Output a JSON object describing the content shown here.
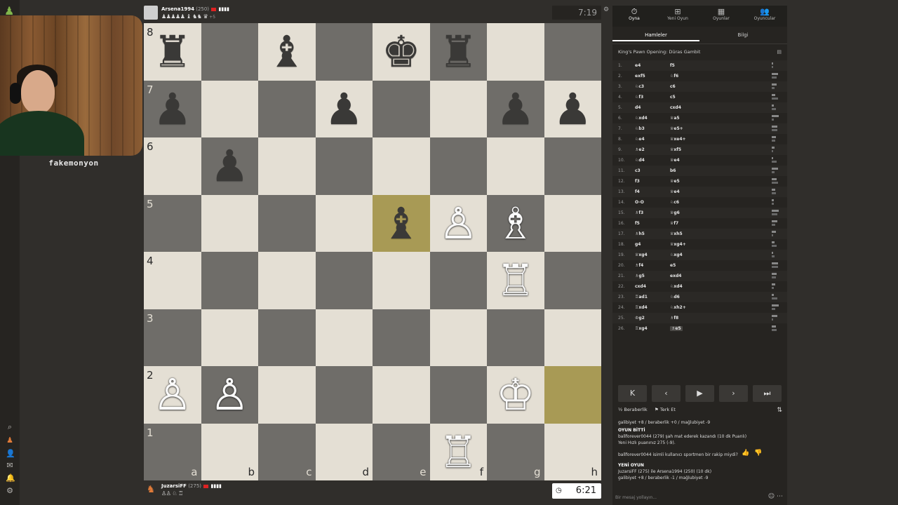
{
  "streamer": {
    "name": "fakemonyon"
  },
  "sidebar": {
    "icons": [
      "search-icon",
      "pawn-icon",
      "friends-icon",
      "messages-icon",
      "bell-icon",
      "gear-icon"
    ],
    "logo": "♟"
  },
  "top_player": {
    "name": "Arsena1994",
    "rating": "(250)",
    "bars": "▮▮▮▮",
    "captured": "♟♟♟♟♟ ♝ ♞♞ ♛",
    "advantage": "+5",
    "clock": "7:19"
  },
  "bottom_player": {
    "name": "JuzarsiFF",
    "rating": "(275)",
    "bars": "▮▮▮▮",
    "captured": "♙♙ ♘ ♖",
    "clock": "6:21"
  },
  "board": {
    "ranks": [
      "8",
      "7",
      "6",
      "5",
      "4",
      "3",
      "2",
      "1"
    ],
    "files": [
      "a",
      "b",
      "c",
      "d",
      "e",
      "f",
      "g",
      "h"
    ],
    "pieces": {
      "a8": "♜",
      "c8": "♝",
      "e8": "♚",
      "f8": "♜",
      "a7": "♟",
      "d7": "♟",
      "g7": "♟",
      "h7": "♟",
      "b6": "♟",
      "e5": "♝",
      "f5": "♙",
      "g5": "♗",
      "g4": "♖",
      "a2": "♙",
      "b2": "♙",
      "g2": "♔",
      "f1": "♖"
    }
  },
  "panel": {
    "tabs": [
      {
        "label": "Oyna",
        "icon": "⏱"
      },
      {
        "label": "Yeni Oyun",
        "icon": "⊞"
      },
      {
        "label": "Oyunlar",
        "icon": "▦"
      },
      {
        "label": "Oyuncular",
        "icon": "👥"
      }
    ],
    "subtabs": [
      "Hamleler",
      "Bilgi"
    ],
    "opening": "King's Pawn Opening: Düras Gambit",
    "moves": [
      {
        "n": "1.",
        "w": "e4",
        "b": "f5"
      },
      {
        "n": "2.",
        "w": "exf5",
        "b": "♘f6"
      },
      {
        "n": "3.",
        "w": "♘c3",
        "b": "c6"
      },
      {
        "n": "4.",
        "w": "♘f3",
        "b": "c5"
      },
      {
        "n": "5.",
        "w": "d4",
        "b": "cxd4"
      },
      {
        "n": "6.",
        "w": "♘xd4",
        "b": "♕a5"
      },
      {
        "n": "7.",
        "w": "♘b3",
        "b": "♕e5+"
      },
      {
        "n": "8.",
        "w": "♘e4",
        "b": "♕xe4+"
      },
      {
        "n": "9.",
        "w": "♗e2",
        "b": "♕xf5"
      },
      {
        "n": "10.",
        "w": "♘d4",
        "b": "♕e4"
      },
      {
        "n": "11.",
        "w": "c3",
        "b": "b6"
      },
      {
        "n": "12.",
        "w": "f3",
        "b": "♕e5"
      },
      {
        "n": "13.",
        "w": "f4",
        "b": "♕e4"
      },
      {
        "n": "14.",
        "w": "O-O",
        "b": "♘c6"
      },
      {
        "n": "15.",
        "w": "♗f3",
        "b": "♕g6"
      },
      {
        "n": "16.",
        "w": "f5",
        "b": "♕f7"
      },
      {
        "n": "17.",
        "w": "♗h5",
        "b": "♕xh5"
      },
      {
        "n": "18.",
        "w": "g4",
        "b": "♕xg4+"
      },
      {
        "n": "19.",
        "w": "♕xg4",
        "b": "♘xg4"
      },
      {
        "n": "20.",
        "w": "♗f4",
        "b": "e5"
      },
      {
        "n": "21.",
        "w": "♗g5",
        "b": "exd4"
      },
      {
        "n": "22.",
        "w": "cxd4",
        "b": "♘xd4"
      },
      {
        "n": "23.",
        "w": "♖ad1",
        "b": "♘d6"
      },
      {
        "n": "24.",
        "w": "♖xd4",
        "b": "♘xh2+"
      },
      {
        "n": "25.",
        "w": "♔g2",
        "b": "♗f8"
      },
      {
        "n": "26.",
        "w": "♖xg4",
        "b": "♗e5"
      }
    ],
    "nav": [
      "K",
      "‹",
      "▶",
      "›",
      "⏭"
    ],
    "actions": {
      "draw": "½ Beraberlik",
      "resign": "⚑ Terk Et"
    },
    "chat": {
      "line1": "galibiyet +8 / beraberlik +0 / mağlubiyet -9",
      "line2": "OYUN BİTTİ",
      "line3": "ballforever0044 (279) şah mat ederek kazandı (10 dk Puanlı)",
      "line4": "Yeni Hızlı puanınız 275 (-9).",
      "line5": "ballforever0044 isimli kullanıcı sportmen bir rakip miydi?",
      "line6": "YENİ OYUN",
      "line7": "JuzarsiFF (275) ile Arsena1994 (250) (10 dk)",
      "line8": "galibiyet +8 / beraberlik -1 / mağlubiyet -9",
      "placeholder": "Bir mesaj yollayın..."
    }
  }
}
